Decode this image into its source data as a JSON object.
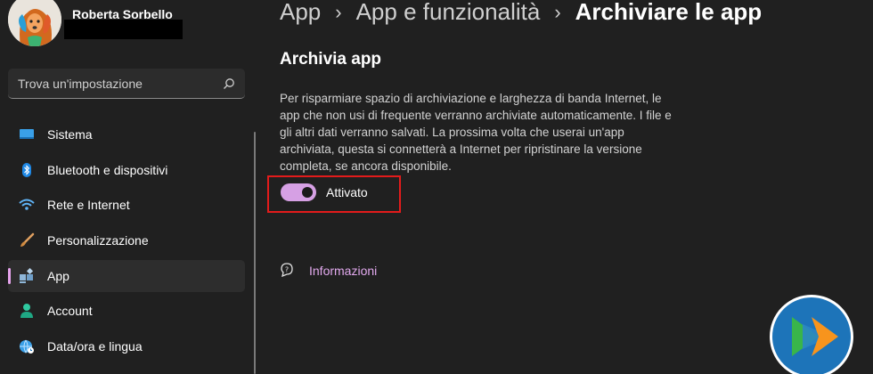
{
  "user": {
    "name": "Roberta Sorbello"
  },
  "search": {
    "placeholder": "Trova un'impostazione",
    "icon": "search-icon"
  },
  "sidebar": {
    "items": [
      {
        "label": "Sistema",
        "icon": "monitor-icon",
        "color": "#3aa0e8"
      },
      {
        "label": "Bluetooth e dispositivi",
        "icon": "bluetooth-icon",
        "color": "#1e88e5"
      },
      {
        "label": "Rete e Internet",
        "icon": "wifi-icon",
        "color": "#5fb3f5"
      },
      {
        "label": "Personalizzazione",
        "icon": "brush-icon",
        "color": "#e0a060"
      },
      {
        "label": "App",
        "icon": "apps-icon",
        "color": "#8fb7d9",
        "active": true
      },
      {
        "label": "Account",
        "icon": "account-icon",
        "color": "#2fc9a0"
      },
      {
        "label": "Data/ora e lingua",
        "icon": "globe-clock-icon",
        "color": "#3aa0e8"
      }
    ]
  },
  "breadcrumb": [
    {
      "label": "App"
    },
    {
      "label": "App e funzionalità"
    },
    {
      "label": "Archiviare le app",
      "current": true
    }
  ],
  "main": {
    "section_title": "Archivia app",
    "description": "Per risparmiare spazio di archiviazione e larghezza di banda Internet, le app che non usi di frequente verranno archiviate automaticamente. I file e gli altri dati verranno salvati. La prossima volta che userai un'app archiviata, questa si connetterà a Internet per ripristinare la versione completa, se ancora disponibile.",
    "toggle": {
      "label": "Attivato",
      "on": true
    },
    "info_link": "Informazioni"
  },
  "colors": {
    "accent": "#e2a9ee",
    "background": "#202020",
    "highlight_box": "#e31b1b"
  },
  "logo": {
    "icon": "play-logo-icon"
  }
}
